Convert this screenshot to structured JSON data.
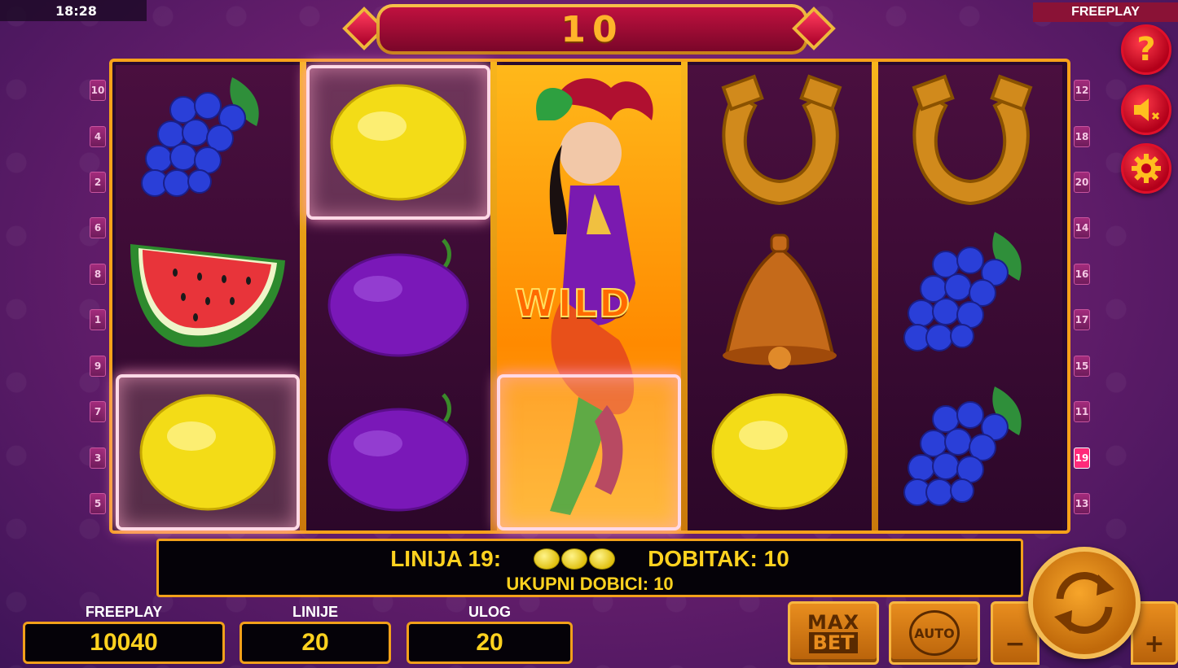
{
  "status_bar": {
    "time": "18:28",
    "mode": "FREEPLAY"
  },
  "win_banner": {
    "value": "10"
  },
  "side_buttons": [
    {
      "name": "help-icon",
      "glyph": "?"
    },
    {
      "name": "sound-muted-icon",
      "glyph": "🔇"
    },
    {
      "name": "settings-icon",
      "glyph": "⚙"
    }
  ],
  "paylines_left": [
    "10",
    "4",
    "2",
    "6",
    "8",
    "1",
    "9",
    "7",
    "3",
    "5"
  ],
  "paylines_right": [
    "12",
    "18",
    "20",
    "14",
    "16",
    "17",
    "15",
    "11",
    "19",
    "13"
  ],
  "active_payline": "19",
  "reels": [
    [
      "grapes",
      "watermelon",
      "lemon"
    ],
    [
      "lemon",
      "plum",
      "plum"
    ],
    [
      "wild-jester",
      "wild-jester",
      "wild-jester"
    ],
    [
      "horseshoe",
      "bell",
      "lemon"
    ],
    [
      "horseshoe",
      "grapes",
      "grapes"
    ]
  ],
  "wild_label": "WILD",
  "info_panel": {
    "line_label": "LINIJA 19:",
    "win_label": "DOBITAK: 10",
    "total_label": "UKUPNI DOBICI: 10"
  },
  "stats": {
    "balance_label": "FREEPLAY",
    "balance_value": "10040",
    "lines_label": "LINIJE",
    "lines_value": "20",
    "bet_label": "ULOG",
    "bet_value": "20"
  },
  "controls": {
    "maxbet_top": "MAX",
    "maxbet_bottom": "BET",
    "auto_label": "AUTO",
    "minus_label": "−",
    "plus_label": "+"
  },
  "colors": {
    "frame": "#f7a21a",
    "info_text": "#ffd21f",
    "banner": "#c0113f",
    "spin": "#f7a52a"
  }
}
